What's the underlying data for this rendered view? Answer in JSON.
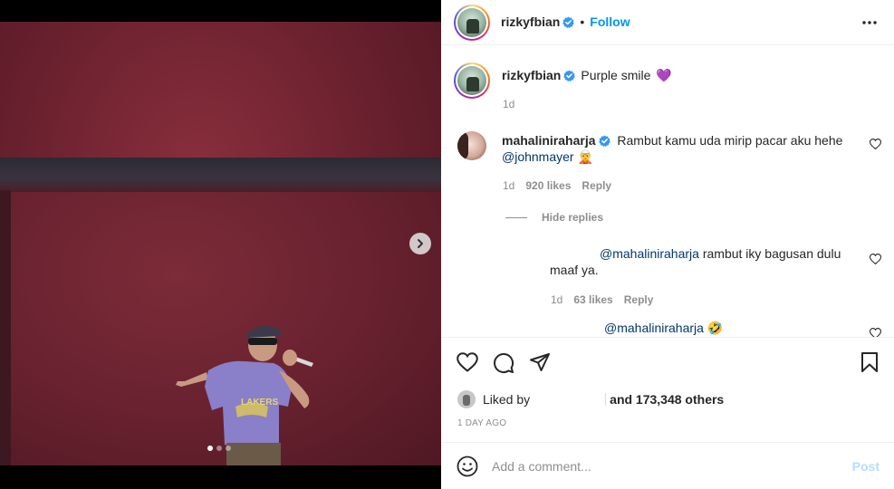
{
  "post": {
    "username": "rizkyfbian",
    "follow_label": "Follow",
    "bullet": "•",
    "caption": "Purple smile",
    "caption_emoji": "💜",
    "caption_time": "1d",
    "media_dots": 3,
    "active_dot": 0
  },
  "comments": [
    {
      "username": "mahaliniraharja",
      "text": "Rambut kamu uda mirip pacar aku hehe",
      "mention": "@johnmayer",
      "emoji": "🧝",
      "time": "1d",
      "likes": "920 likes",
      "reply_label": "Reply",
      "hide_replies_label": "Hide replies"
    }
  ],
  "replies": [
    {
      "mention": "@mahaliniraharja",
      "text": "rambut iky bagusan dulu maaf ya.",
      "line2": "maaf ya.",
      "line1": "rambut iky bagusan dulu",
      "time": "1d",
      "likes": "63 likes",
      "reply_label": "Reply"
    },
    {
      "mention": "@mahaliniraharja",
      "emoji": "🤣"
    }
  ],
  "likes_summary": {
    "prefix": "Liked by",
    "suffix": "and 173,348 others"
  },
  "timestamp": "1 DAY AGO",
  "comment_input": {
    "placeholder": "Add a comment...",
    "post_label": "Post"
  },
  "colors": {
    "accent": "#0095f6",
    "verified": "#3897f0",
    "heart_emoji": "#9b59d0",
    "post_disabled": "#b2dffc"
  },
  "icons": [
    "verified-badge-icon",
    "more-options-icon",
    "heart-icon",
    "comment-icon",
    "share-icon",
    "bookmark-icon",
    "emoji-icon",
    "chevron-right-icon"
  ]
}
